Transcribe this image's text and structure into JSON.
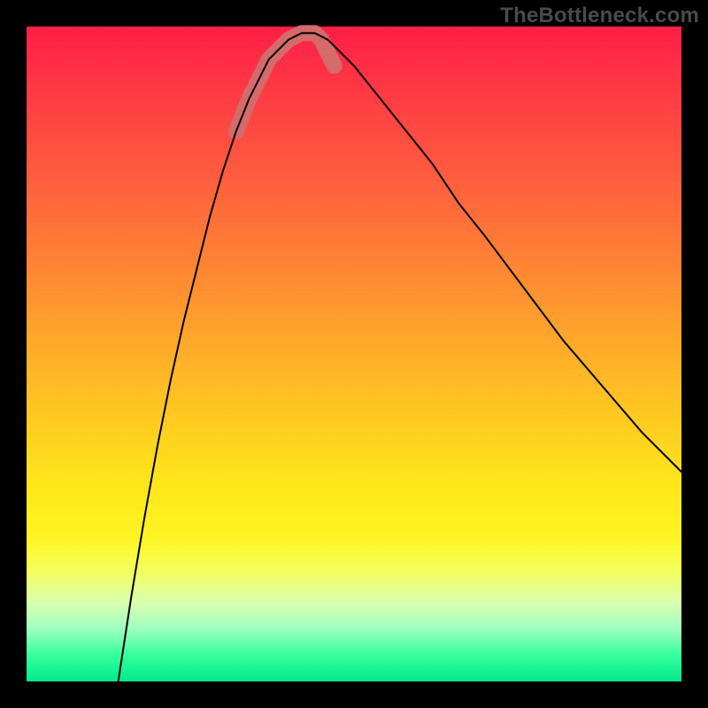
{
  "watermark": "TheBottleneck.com",
  "chart_data": {
    "type": "line",
    "title": "",
    "xlabel": "",
    "ylabel": "",
    "xlim": [
      0,
      100
    ],
    "ylim": [
      0,
      100
    ],
    "background_gradient": {
      "top": "#ff1e46",
      "mid": "#ffe61a",
      "bottom": "#00e98a"
    },
    "series": [
      {
        "name": "bottleneck-curve",
        "x": [
          14,
          16,
          18,
          20,
          22,
          24,
          26,
          28,
          30,
          32,
          34,
          36,
          37,
          38,
          40,
          42,
          43,
          44,
          46,
          48,
          50,
          54,
          58,
          62,
          66,
          70,
          76,
          82,
          88,
          94,
          100
        ],
        "y": [
          0,
          13,
          25,
          36,
          46,
          55,
          63,
          71,
          78,
          84,
          89,
          93,
          95,
          96,
          98,
          99,
          99,
          99,
          98,
          96,
          94,
          89,
          84,
          79,
          73,
          68,
          60,
          52,
          45,
          38,
          32
        ],
        "stroke": "#000000",
        "stroke_width": 2
      },
      {
        "name": "highlight-left",
        "x": [
          32,
          34,
          36,
          37
        ],
        "y": [
          84,
          89,
          93,
          95
        ],
        "stroke": "#d46a6a",
        "stroke_width": 18
      },
      {
        "name": "highlight-bottom",
        "x": [
          37,
          38,
          40,
          42,
          43
        ],
        "y": [
          95,
          96,
          98,
          99,
          99
        ],
        "stroke": "#d46a6a",
        "stroke_width": 18
      },
      {
        "name": "highlight-right",
        "x": [
          43,
          44,
          45,
          46,
          47
        ],
        "y": [
          99,
          99,
          98,
          96,
          94
        ],
        "stroke": "#d46a6a",
        "stroke_width": 18
      }
    ]
  }
}
